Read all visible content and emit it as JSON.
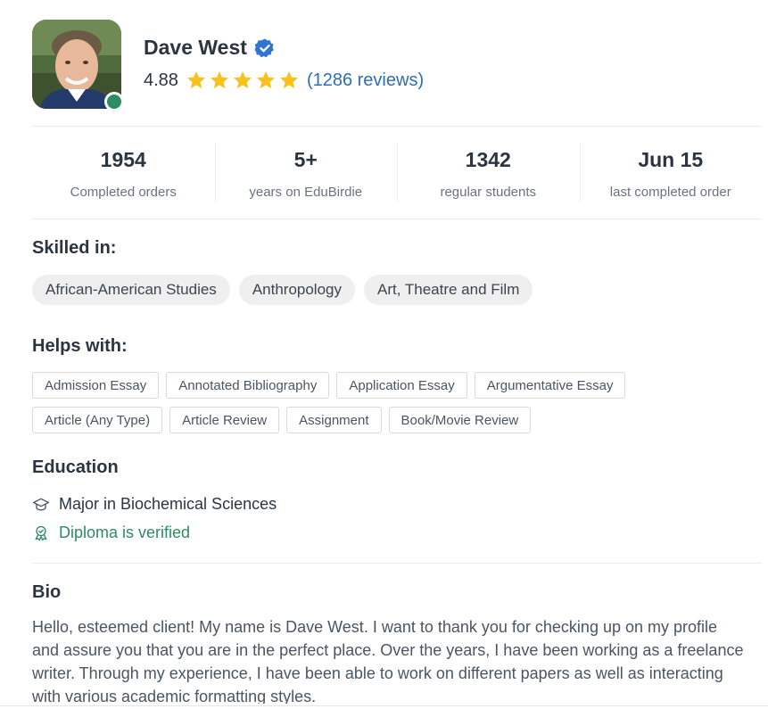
{
  "profile": {
    "name": "Dave West",
    "rating": "4.88",
    "stars": 5,
    "reviews": "(1286 reviews)",
    "online": true
  },
  "stats": [
    {
      "value": "1954",
      "label": "Completed orders"
    },
    {
      "value": "5+",
      "label": "years on EduBirdie"
    },
    {
      "value": "1342",
      "label": "regular students"
    },
    {
      "value": "Jun 15",
      "label": "last completed order"
    }
  ],
  "skills": {
    "title": "Skilled in:",
    "items": [
      "African-American Studies",
      "Anthropology",
      "Art, Theatre and Film"
    ]
  },
  "helps": {
    "title": "Helps with:",
    "items": [
      "Admission Essay",
      "Annotated Bibliography",
      "Application Essay",
      "Argumentative Essay",
      "Article (Any Type)",
      "Article Review",
      "Assignment",
      "Book/Movie Review"
    ]
  },
  "education": {
    "title": "Education",
    "major": "Major in Biochemical Sciences",
    "diploma": "Diploma is verified"
  },
  "bio": {
    "title": "Bio",
    "text": "Hello, esteemed client! My name is Dave West. I want to thank you for checking up on my profile and assure you that you are in the perfect place. Over the years, I have been working as a freelance writer. Through my experience, I have been able to work on different papers as well as interacting with various academic formatting styles."
  },
  "colors": {
    "accent_blue": "#2f6eb5",
    "star_gold": "#f7c21b",
    "online_green": "#2e8b62",
    "verified_blue": "#2f74d0"
  }
}
